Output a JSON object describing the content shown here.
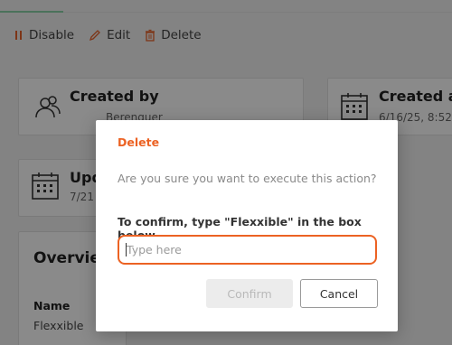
{
  "toolbar": {
    "disable_label": "Disable",
    "edit_label": "Edit",
    "delete_label": "Delete"
  },
  "cards": {
    "created_by": {
      "title": "Created by",
      "value": "Berenguer"
    },
    "created_at": {
      "title": "Created at",
      "value": "6/16/25, 8:52"
    },
    "updated": {
      "title": "Upd",
      "value": "7/21"
    },
    "overview": {
      "title": "Overvie",
      "name_label": "Name",
      "name_value": "Flexxible"
    }
  },
  "modal": {
    "title": "Delete",
    "question": "Are you sure you want to execute this action?",
    "confirm_instruction": "To confirm, type \"Flexxible\" in the box below",
    "input_value": "",
    "input_placeholder": "Type here",
    "confirm_label": "Confirm",
    "cancel_label": "Cancel"
  },
  "colors": {
    "accent": "#ec6223",
    "toolbar_accent": "#e8632b"
  }
}
